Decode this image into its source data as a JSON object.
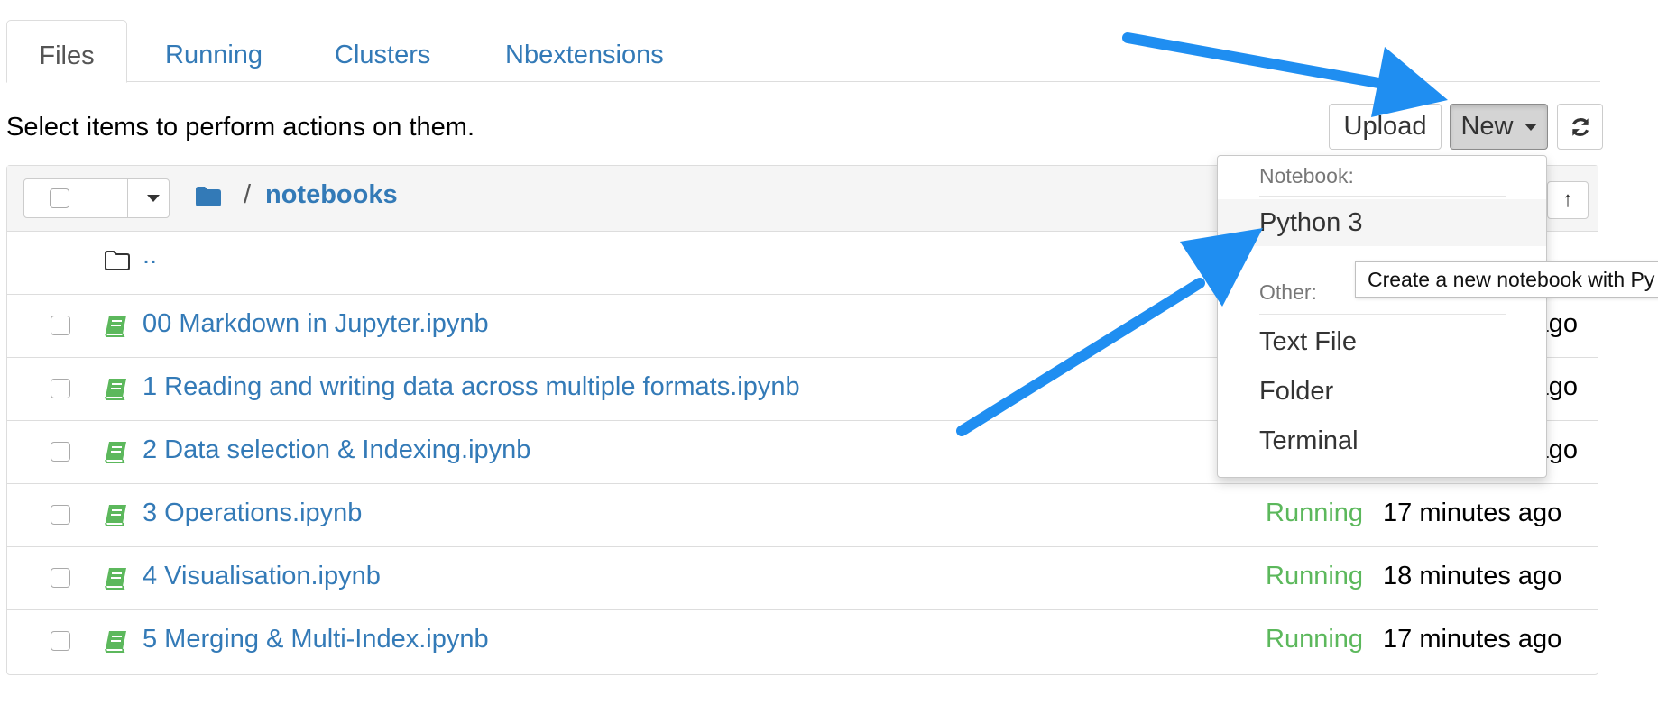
{
  "tabs": [
    {
      "label": "Files",
      "active": true
    },
    {
      "label": "Running"
    },
    {
      "label": "Clusters"
    },
    {
      "label": "Nbextensions"
    }
  ],
  "instructions": "Select items to perform actions on them.",
  "toolbar": {
    "upload_label": "Upload",
    "new_label": "New",
    "refresh_icon": "refresh-icon"
  },
  "breadcrumb": {
    "root_icon": "folder-icon",
    "separator": "/",
    "current": "notebooks"
  },
  "list": {
    "updir_label": "..",
    "items": [
      {
        "name": "00 Markdown in Jupyter.ipynb",
        "status": "",
        "modified": "ago"
      },
      {
        "name": "1 Reading and writing data across multiple formats.ipynb",
        "status": "",
        "modified": "ago"
      },
      {
        "name": "2 Data selection & Indexing.ipynb",
        "status": "",
        "modified": "ago"
      },
      {
        "name": "3 Operations.ipynb",
        "status": "Running",
        "modified": "17 minutes ago"
      },
      {
        "name": "4 Visualisation.ipynb",
        "status": "Running",
        "modified": "18 minutes ago"
      },
      {
        "name": "5 Merging & Multi-Index.ipynb",
        "status": "Running",
        "modified": "17 minutes ago"
      }
    ]
  },
  "new_menu": {
    "notebook_header": "Notebook:",
    "python3": "Python 3",
    "other_header": "Other:",
    "text_file": "Text File",
    "folder": "Folder",
    "terminal": "Terminal"
  },
  "tooltip": "Create a new notebook with Py",
  "colors": {
    "link": "#337ab7",
    "running": "#5cb85c",
    "notebook_icon": "#5cb85c",
    "annotation_arrow": "#1f8ef1"
  }
}
